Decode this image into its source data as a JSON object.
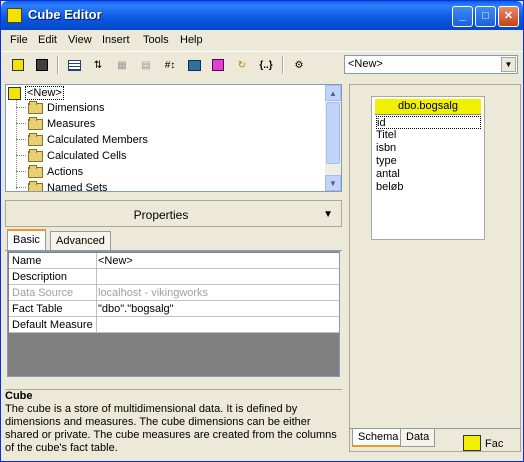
{
  "window": {
    "title": "Cube Editor"
  },
  "menu": [
    "File",
    "Edit",
    "View",
    "Insert",
    "Tools",
    "Help"
  ],
  "combo": {
    "value": "<New>",
    "arrow": "▼"
  },
  "tree": {
    "root": "<New>",
    "items": [
      "Dimensions",
      "Measures",
      "Calculated Members",
      "Calculated Cells",
      "Actions",
      "Named Sets"
    ]
  },
  "properties": {
    "bar_label": "Properties",
    "tabs": [
      "Basic",
      "Advanced"
    ],
    "rows": [
      {
        "name": "Name",
        "value": "<New>"
      },
      {
        "name": "Description",
        "value": ""
      },
      {
        "name": "Data Source",
        "value": "localhost - vikingworks",
        "disabled": true
      },
      {
        "name": "Fact Table",
        "value": "\"dbo\".\"bogsalg\""
      },
      {
        "name": "Default Measure",
        "value": ""
      }
    ]
  },
  "description": {
    "heading": "Cube",
    "text": "The cube is a store of multidimensional data. It is defined by dimensions and measures. The cube dimensions can be either shared or private. The cube measures are created from the columns of the cube's fact table."
  },
  "schema": {
    "table_name": "dbo.bogsalg",
    "fields": [
      "id",
      "Titel",
      "isbn",
      "type",
      "antal",
      "beløb"
    ],
    "tabs": [
      "Schema",
      "Data"
    ],
    "legend_label": "Fac",
    "fact_color": "#f0f000"
  }
}
